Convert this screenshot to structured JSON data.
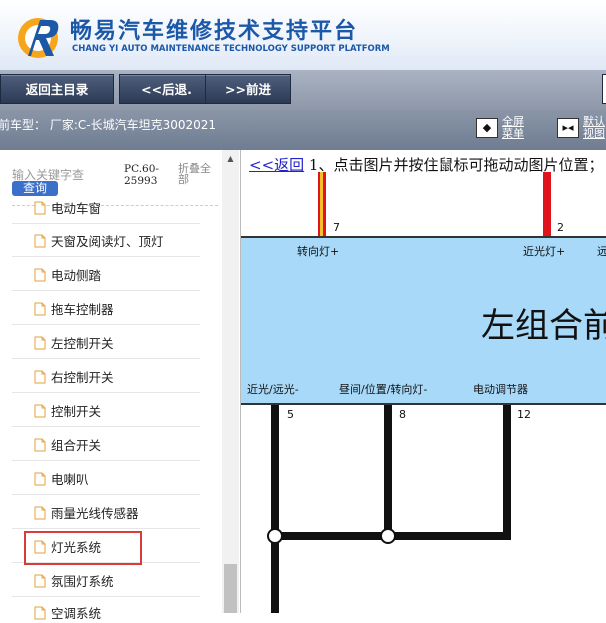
{
  "header": {
    "title": "畅易汽车维修技术支持平台",
    "subtitle": "CHANG YI AUTO MAINTENANCE TECHNOLOGY SUPPORT PLATFORM"
  },
  "toolbar": {
    "home_label": "返回主目录",
    "back_label": "<<后退.",
    "forward_label": ">>前进"
  },
  "infobar": {
    "car_model": "前车型： 厂家:C-长城汽车坦克3002021",
    "fullscreen_label_1": "全屏",
    "fullscreen_label_2": "菜单",
    "default_view_label_1": "默认",
    "default_view_label_2": "视图"
  },
  "sidebar": {
    "search_placeholder": "输入关键字查",
    "search_button": "查询",
    "pc_code_1": "PC.60-",
    "pc_code_2": "25993",
    "collapse_1": "折叠全",
    "collapse_2": "部",
    "items": [
      {
        "label": "电动车窗"
      },
      {
        "label": "天窗及阅读灯、顶灯"
      },
      {
        "label": "电动侧踏"
      },
      {
        "label": "拖车控制器"
      },
      {
        "label": "左控制开关"
      },
      {
        "label": "右控制开关"
      },
      {
        "label": "控制开关"
      },
      {
        "label": "组合开关"
      },
      {
        "label": "电喇叭"
      },
      {
        "label": "雨量光线传感器"
      },
      {
        "label": "灯光系统"
      },
      {
        "label": "氛围灯系统"
      },
      {
        "label": "空调系统"
      }
    ]
  },
  "diagram": {
    "back_link": "<<返回",
    "hint": " 1、点击图片并按住鼠标可拖动动图片位置；",
    "component": "左组合前",
    "top_pins": [
      {
        "num": "7",
        "label": "转向灯+"
      },
      {
        "num": "2",
        "label": "近光灯+"
      },
      {
        "label": "远"
      }
    ],
    "bottom_pins": [
      {
        "num": "5",
        "label": "近光/远光-"
      },
      {
        "num": "8",
        "label": "昼间/位置/转向灯-"
      },
      {
        "num": "12",
        "label": "电动调节器"
      }
    ]
  },
  "colors": {
    "brand_blue": "#1c58a8",
    "panel_blue": "#a8d9f8",
    "wire_red": "#e0141c",
    "highlight": "#d93a3a"
  }
}
